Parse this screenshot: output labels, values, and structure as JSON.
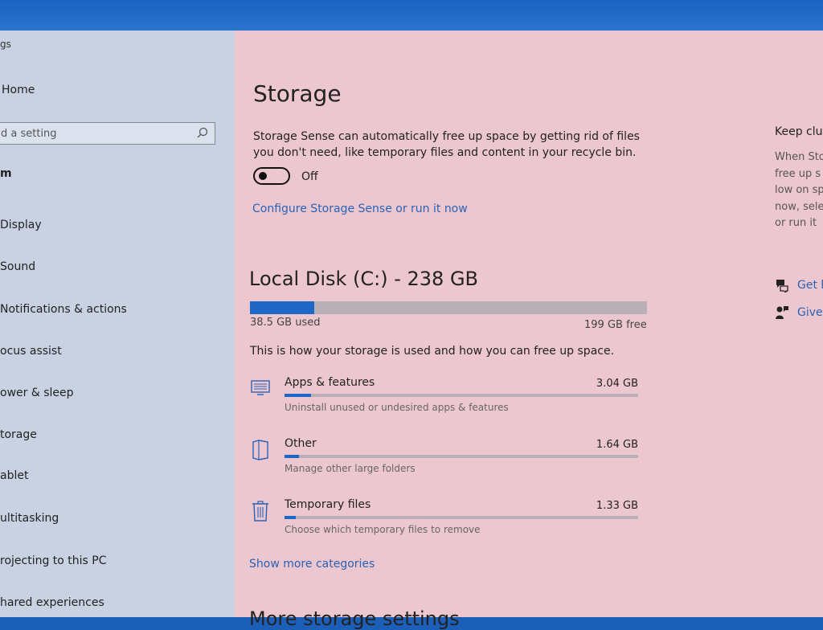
{
  "app": {
    "title": "gs"
  },
  "sidebar": {
    "home_label": "Home",
    "search": {
      "value": "d a setting"
    },
    "section_label": "m",
    "items": [
      {
        "label": "Display"
      },
      {
        "label": "Sound"
      },
      {
        "label": "Notifications & actions"
      },
      {
        "label": "ocus assist"
      },
      {
        "label": "ower & sleep"
      },
      {
        "label": "torage"
      },
      {
        "label": "ablet"
      },
      {
        "label": "ultitasking"
      },
      {
        "label": "rojecting to this PC"
      },
      {
        "label": "hared experiences"
      }
    ]
  },
  "main": {
    "title": "Storage",
    "sense_description_line1": "Storage Sense can automatically free up space by getting rid of files",
    "sense_description_line2": "you don't need, like temporary files and content in your recycle bin.",
    "toggle": {
      "state": "Off",
      "on": false
    },
    "configure_link": "Configure Storage Sense or run it now",
    "disk": {
      "title": "Local Disk (C:) - 238 GB",
      "used_label": "38.5 GB used",
      "free_label": "199 GB free",
      "used_fraction": 0.162
    },
    "storage_description": "This is how your storage is used and how you can free up space.",
    "categories": [
      {
        "name": "Apps & features",
        "size": "3.04 GB",
        "description": "Uninstall unused or undesired apps & features",
        "fraction": 0.075,
        "icon": "monitor-icon"
      },
      {
        "name": "Other",
        "size": "1.64 GB",
        "description": "Manage other large folders",
        "fraction": 0.04,
        "icon": "folder-icon"
      },
      {
        "name": "Temporary files",
        "size": "1.33 GB",
        "description": "Choose which temporary files to remove",
        "fraction": 0.032,
        "icon": "trash-icon"
      }
    ],
    "more_link": "Show more categories",
    "bottom_heading": "More storage settings"
  },
  "right_panel": {
    "title": "Keep clutter",
    "lines": [
      "When Sto",
      "free up s",
      "low on sp",
      "now, sele",
      "or run it"
    ],
    "links": [
      {
        "label": "Get help",
        "icon": "help-chat-icon"
      },
      {
        "label": "Give feedback",
        "icon": "feedback-icon"
      }
    ]
  },
  "colors": {
    "accent": "#1f67c6",
    "link": "#2a62b5",
    "background": "#ecc7d0",
    "sidebar": "#c8d2e2"
  }
}
